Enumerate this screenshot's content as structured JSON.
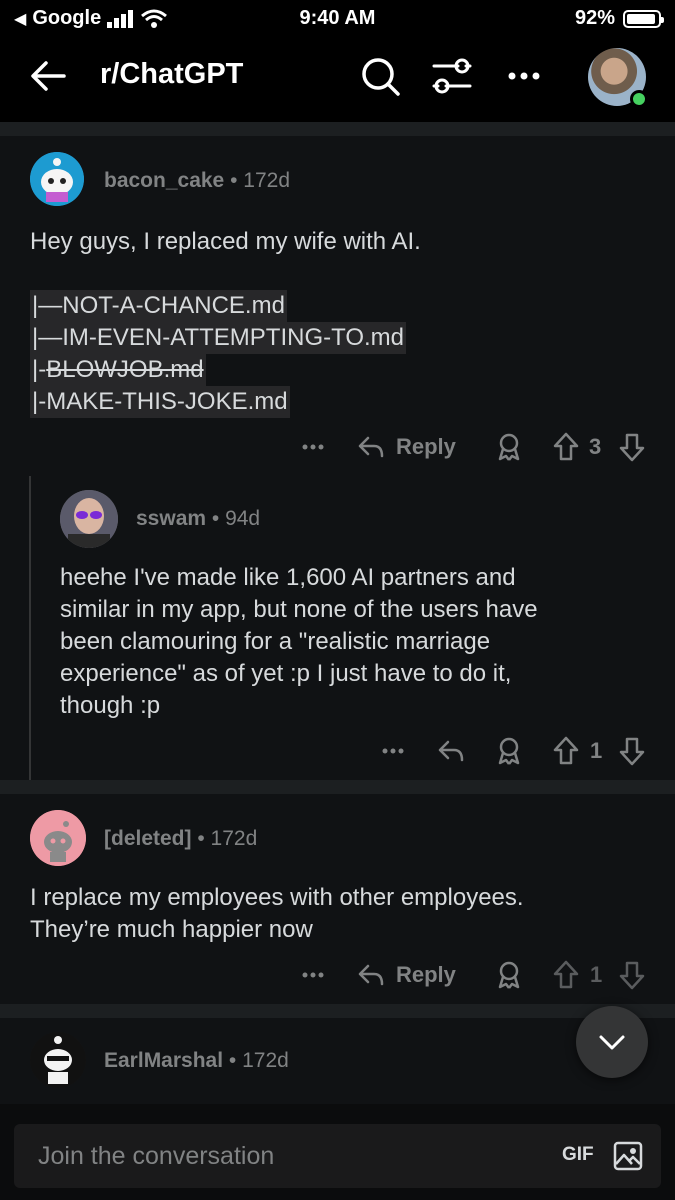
{
  "status": {
    "carrier": "Google",
    "time": "9:40 AM",
    "battery": "92%"
  },
  "header": {
    "title": "r/ChatGPT"
  },
  "comments": [
    {
      "user": "bacon_cake",
      "age": "• 172d",
      "text": "Hey guys, I replaced my wife with AI.",
      "code_lines": [
        "|—NOT-A-CHANCE.md",
        "|—IM-EVEN-ATTEMPTING-TO.md",
        "BLOWJOB.md",
        "|-MAKE-THIS-JOKE.md"
      ],
      "code_prefix_3": "|-",
      "reply_label": "Reply",
      "votes": "3"
    },
    {
      "user": "sswam",
      "age": "• 94d",
      "text_lines": [
        "heehe I've made like 1,600 AI partners and",
        "similar in my app, but none of the users have",
        "been clamouring for a \"realistic marriage",
        "experience\" as of yet :p  I just have to do it,",
        "though :p"
      ],
      "votes": "1"
    },
    {
      "user": "[deleted]",
      "age": "• 172d",
      "text_lines": [
        "I replace my employees with other employees.",
        "They’re much happier now"
      ],
      "reply_label": "Reply",
      "votes": "1"
    },
    {
      "user": "EarlMarshal",
      "age": "• 172d"
    }
  ],
  "composer": {
    "placeholder": "Join the conversation",
    "gif_label": "GIF"
  },
  "colors": {
    "background": "#000000",
    "card": "#101214",
    "muted": "#818384",
    "text": "#d7dadc"
  }
}
